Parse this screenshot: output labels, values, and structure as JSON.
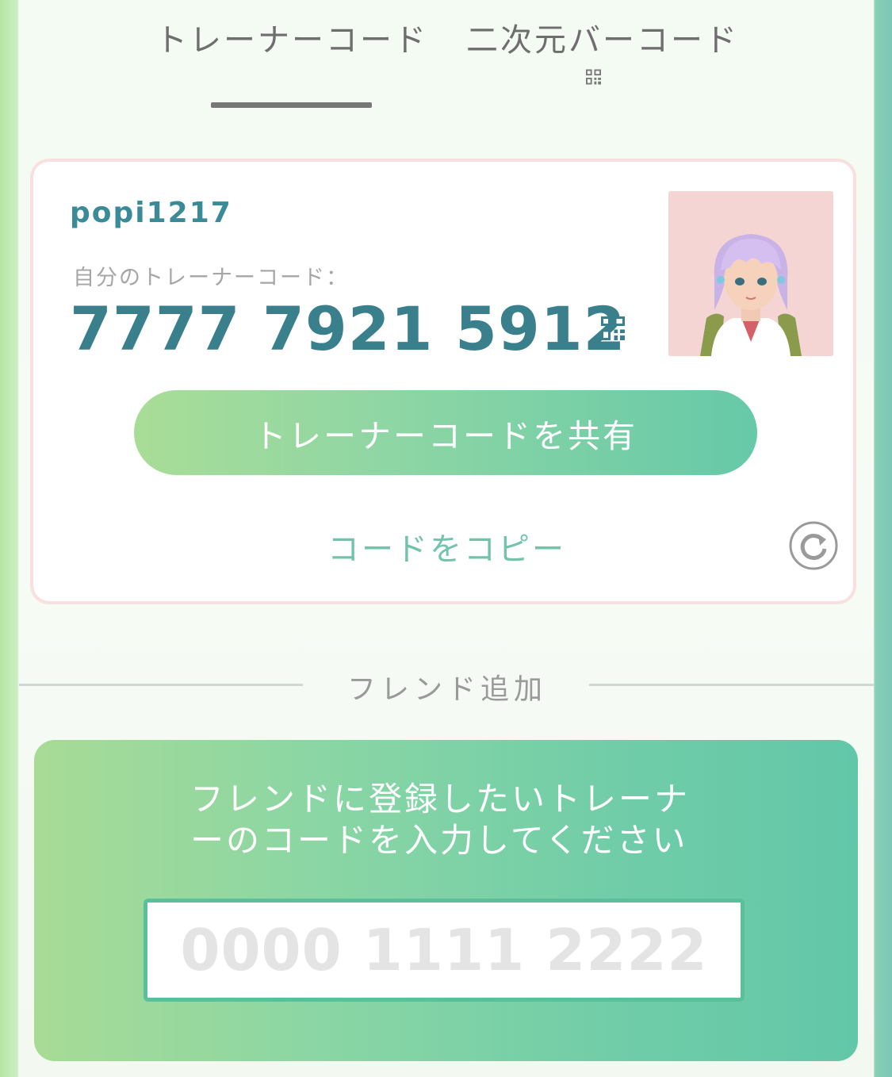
{
  "tabs": {
    "trainer_code": "トレーナーコード",
    "qr_code": "二次元バーコード"
  },
  "card": {
    "username": "popi1217",
    "code_label": "自分のトレーナーコード：",
    "code_value": "7777 7921 5912",
    "share_button": "トレーナーコードを共有",
    "copy_link": "コードをコピー"
  },
  "add_friend": {
    "section_title": "フレンド追加",
    "instruction": "フレンドに登録したいトレーナーのコードを入力してください",
    "input_placeholder": "0000 1111 2222",
    "input_value": ""
  },
  "icons": {
    "tab_qr": "qr-code-icon",
    "card_qr": "qr-code-icon",
    "refresh": "refresh-icon",
    "avatar": "trainer-avatar"
  },
  "colors": {
    "accent_teal": "#3a8a98",
    "button_gradient_start": "#a9dd97",
    "button_gradient_end": "#66c9a8",
    "card_border": "#f7e0df",
    "avatar_bg": "#f5d5d3"
  }
}
